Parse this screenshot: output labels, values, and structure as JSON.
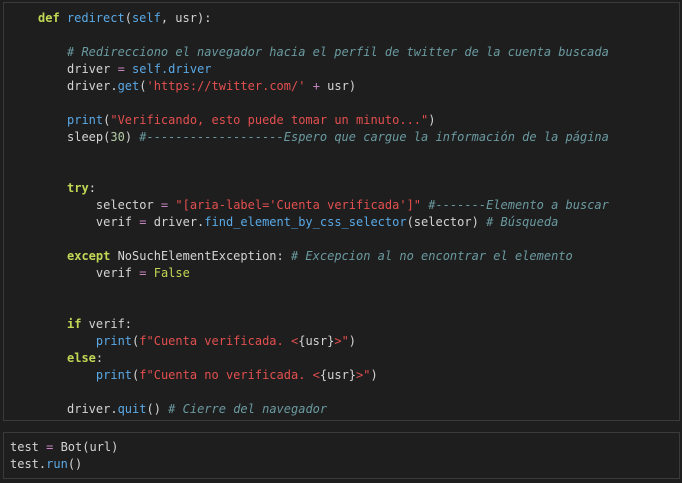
{
  "cell1": {
    "lines": [
      {
        "t": [
          {
            "c": "kw",
            "v": "def "
          },
          {
            "c": "fn",
            "v": "redirect"
          },
          {
            "c": "txt",
            "v": "("
          },
          {
            "c": "self",
            "v": "self"
          },
          {
            "c": "txt",
            "v": ", usr):"
          }
        ]
      },
      {
        "t": []
      },
      {
        "t": [
          {
            "c": "cmt",
            "v": "# Redirecciono el navegador hacia el perfil de twitter de la cuenta buscada"
          }
        ]
      },
      {
        "t": [
          {
            "c": "txt",
            "v": "driver "
          },
          {
            "c": "op",
            "v": "="
          },
          {
            "c": "txt",
            "v": " "
          },
          {
            "c": "self",
            "v": "self.driver"
          }
        ]
      },
      {
        "t": [
          {
            "c": "txt",
            "v": "driver."
          },
          {
            "c": "fn",
            "v": "get"
          },
          {
            "c": "txt",
            "v": "("
          },
          {
            "c": "str",
            "v": "'https://twitter.com/'"
          },
          {
            "c": "txt",
            "v": " "
          },
          {
            "c": "op",
            "v": "+"
          },
          {
            "c": "txt",
            "v": " usr)"
          }
        ]
      },
      {
        "t": []
      },
      {
        "t": [
          {
            "c": "fn",
            "v": "print"
          },
          {
            "c": "txt",
            "v": "("
          },
          {
            "c": "str",
            "v": "\"Verificando, esto puede tomar un minuto...\""
          },
          {
            "c": "txt",
            "v": ")"
          }
        ]
      },
      {
        "t": [
          {
            "c": "txt",
            "v": "sleep("
          },
          {
            "c": "num",
            "v": "30"
          },
          {
            "c": "txt",
            "v": ") "
          },
          {
            "c": "cmt",
            "v": "#-------------------Espero que cargue la información de la página"
          }
        ]
      },
      {
        "t": []
      },
      {
        "t": []
      },
      {
        "t": [
          {
            "c": "kw",
            "v": "try"
          },
          {
            "c": "txt",
            "v": ":"
          }
        ]
      },
      {
        "t": [
          {
            "c": "txt",
            "v": "    selector "
          },
          {
            "c": "op",
            "v": "="
          },
          {
            "c": "txt",
            "v": " "
          },
          {
            "c": "str",
            "v": "\"[aria-label='Cuenta verificada']\""
          },
          {
            "c": "txt",
            "v": " "
          },
          {
            "c": "cmt",
            "v": "#-------Elemento a buscar"
          }
        ]
      },
      {
        "t": [
          {
            "c": "txt",
            "v": "    verif "
          },
          {
            "c": "op",
            "v": "="
          },
          {
            "c": "txt",
            "v": " driver."
          },
          {
            "c": "fn",
            "v": "find_element_by_css_selector"
          },
          {
            "c": "txt",
            "v": "(selector) "
          },
          {
            "c": "cmt",
            "v": "# Búsqueda"
          }
        ]
      },
      {
        "t": []
      },
      {
        "t": [
          {
            "c": "kw",
            "v": "except"
          },
          {
            "c": "txt",
            "v": " NoSuchElementException: "
          },
          {
            "c": "cmt",
            "v": "# Excepcion al no encontrar el elemento"
          }
        ]
      },
      {
        "t": [
          {
            "c": "txt",
            "v": "    verif "
          },
          {
            "c": "op",
            "v": "="
          },
          {
            "c": "txt",
            "v": " "
          },
          {
            "c": "const",
            "v": "False"
          }
        ]
      },
      {
        "t": []
      },
      {
        "t": []
      },
      {
        "t": [
          {
            "c": "kw",
            "v": "if"
          },
          {
            "c": "txt",
            "v": " verif:"
          }
        ]
      },
      {
        "t": [
          {
            "c": "txt",
            "v": "    "
          },
          {
            "c": "fn",
            "v": "print"
          },
          {
            "c": "txt",
            "v": "("
          },
          {
            "c": "str",
            "v": "f\"Cuenta verificada. <"
          },
          {
            "c": "txt",
            "v": "{usr}"
          },
          {
            "c": "str",
            "v": ">\""
          },
          {
            "c": "txt",
            "v": ")"
          }
        ]
      },
      {
        "t": [
          {
            "c": "kw",
            "v": "else"
          },
          {
            "c": "txt",
            "v": ":"
          }
        ]
      },
      {
        "t": [
          {
            "c": "txt",
            "v": "    "
          },
          {
            "c": "fn",
            "v": "print"
          },
          {
            "c": "txt",
            "v": "("
          },
          {
            "c": "str",
            "v": "f\"Cuenta no verificada. <"
          },
          {
            "c": "txt",
            "v": "{usr}"
          },
          {
            "c": "str",
            "v": ">\""
          },
          {
            "c": "txt",
            "v": ")"
          }
        ]
      },
      {
        "t": []
      },
      {
        "t": [
          {
            "c": "txt",
            "v": "driver."
          },
          {
            "c": "fn",
            "v": "quit"
          },
          {
            "c": "txt",
            "v": "() "
          },
          {
            "c": "cmt",
            "v": "# Cierre del navegador"
          }
        ]
      }
    ]
  },
  "cell2": {
    "lines": [
      {
        "t": [
          {
            "c": "txt",
            "v": "test "
          },
          {
            "c": "op",
            "v": "="
          },
          {
            "c": "txt",
            "v": " Bot(url)"
          }
        ]
      },
      {
        "t": [
          {
            "c": "txt",
            "v": "test."
          },
          {
            "c": "runfn",
            "v": "run"
          },
          {
            "c": "txt",
            "v": "()"
          }
        ]
      }
    ]
  }
}
